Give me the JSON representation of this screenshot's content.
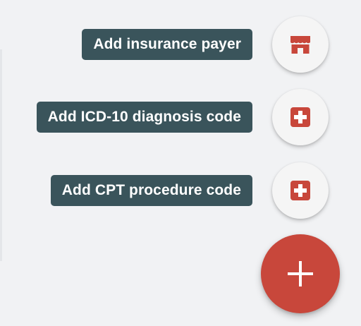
{
  "speed_dial": {
    "actions": [
      {
        "label": "Add insurance payer",
        "icon": "store-icon"
      },
      {
        "label": "Add ICD-10 diagnosis code",
        "icon": "medical-cross-icon"
      },
      {
        "label": "Add CPT procedure code",
        "icon": "medical-cross-icon"
      }
    ],
    "main_icon": "plus-icon"
  },
  "colors": {
    "accent": "#c8473b",
    "tooltip_bg": "#3a545b",
    "mini_fab_bg": "#f5f5f5",
    "page_bg": "#f1f2f4"
  }
}
